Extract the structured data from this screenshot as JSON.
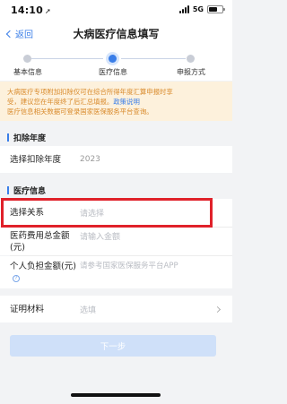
{
  "status_bar": {
    "time": "14:10",
    "location_glyph": "➚",
    "network": "5G",
    "battery_level": 0.65
  },
  "nav": {
    "back_label": "返回",
    "title": "大病医疗信息填写"
  },
  "steps": [
    {
      "label": "基本信息",
      "active": false
    },
    {
      "label": "医疗信息",
      "active": true
    },
    {
      "label": "申报方式",
      "active": false
    }
  ],
  "notice": {
    "line1": "大病医疗专项附加扣除仅可在综合所得年度汇算申报时享",
    "line2_prefix": "受，建议您在年度终了后汇总填报。",
    "line2_link": "政策说明",
    "line3": "医疗信息相关数据可登录国家医保服务平台查询。"
  },
  "sections": {
    "deduction_year": "扣除年度",
    "medical_info": "医疗信息"
  },
  "form": {
    "year_label": "选择扣除年度",
    "year_value": "2023",
    "relation_label": "选择关系",
    "relation_placeholder": "请选择",
    "total_label": "医药费用总金额(元)",
    "total_placeholder": "请输入金额",
    "self_pay_label": "个人负担金额(元)",
    "self_pay_placeholder": "请参考国家医保服务平台APP",
    "proof_label": "证明材料",
    "proof_placeholder": "选填"
  },
  "next_button": "下一步",
  "colors": {
    "accent": "#3a7ee8",
    "notice_bg": "#fdf1dc",
    "notice_text": "#d98a2b",
    "highlight": "#e0212a"
  },
  "icons": [
    "location-arrow-icon",
    "signal-icon",
    "battery-icon",
    "back-chevron-icon",
    "help-icon",
    "chevron-right-icon"
  ]
}
